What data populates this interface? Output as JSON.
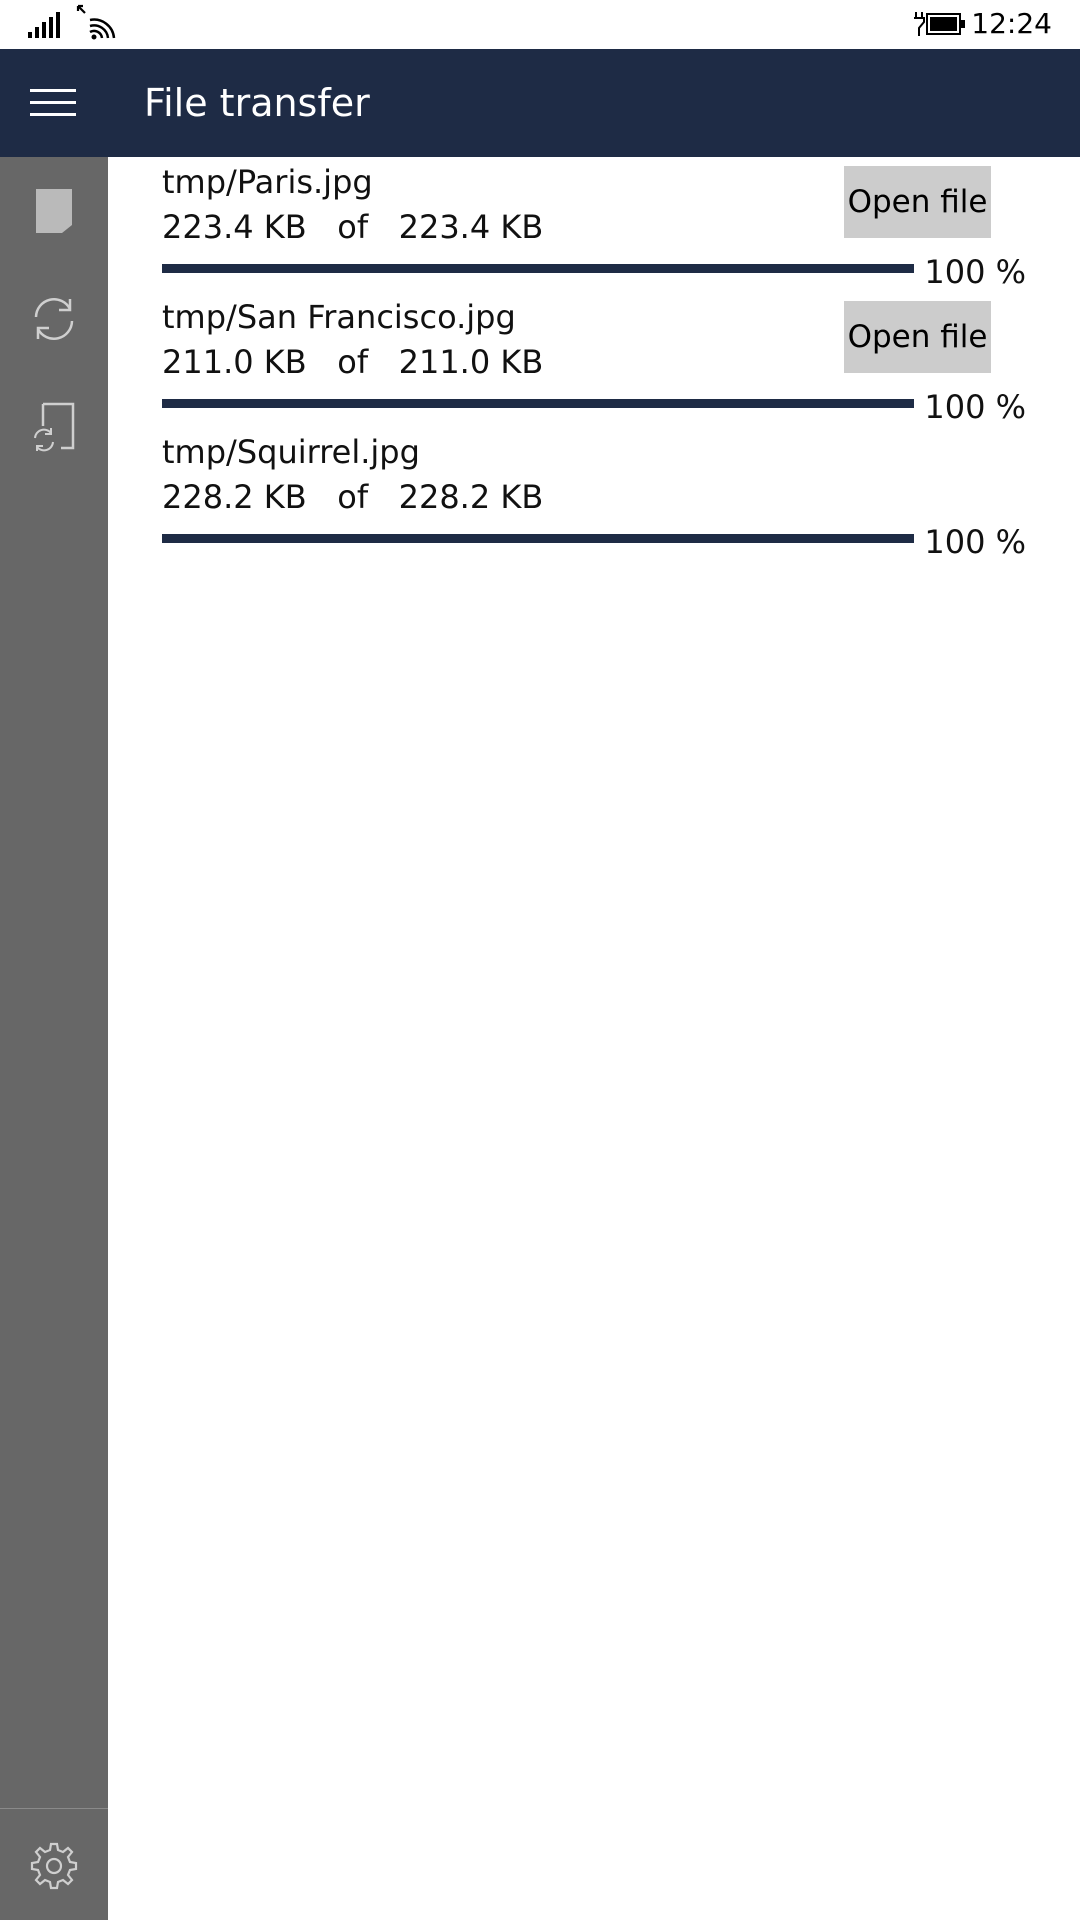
{
  "status_bar": {
    "time": "12:24",
    "signal_icon": "cellular-signal-icon",
    "wifi_icon": "wifi-icon",
    "battery_icon": "battery-charging-icon"
  },
  "header": {
    "menu_icon": "hamburger-menu-icon",
    "title": "File transfer",
    "background_color": "#1e2b45"
  },
  "sidebar": {
    "items": [
      {
        "icon": "document-icon"
      },
      {
        "icon": "sync-icon"
      },
      {
        "icon": "file-sync-icon"
      }
    ],
    "settings_icon": "gear-icon",
    "background_color": "#676767"
  },
  "transfers": [
    {
      "name": "tmp/Paris.jpg",
      "received": "223.4 KB",
      "of_label": "of",
      "total": "223.4 KB",
      "progress_percent": 100,
      "percent_label": "100 %",
      "open_label": "Open file",
      "has_open_button": true
    },
    {
      "name": "tmp/San Francisco.jpg",
      "received": "211.0 KB",
      "of_label": "of",
      "total": "211.0 KB",
      "progress_percent": 100,
      "percent_label": "100 %",
      "open_label": "Open file",
      "has_open_button": true
    },
    {
      "name": "tmp/Squirrel.jpg",
      "received": "228.2 KB",
      "of_label": "of",
      "total": "228.2 KB",
      "progress_percent": 100,
      "percent_label": "100 %",
      "has_open_button": false
    }
  ]
}
